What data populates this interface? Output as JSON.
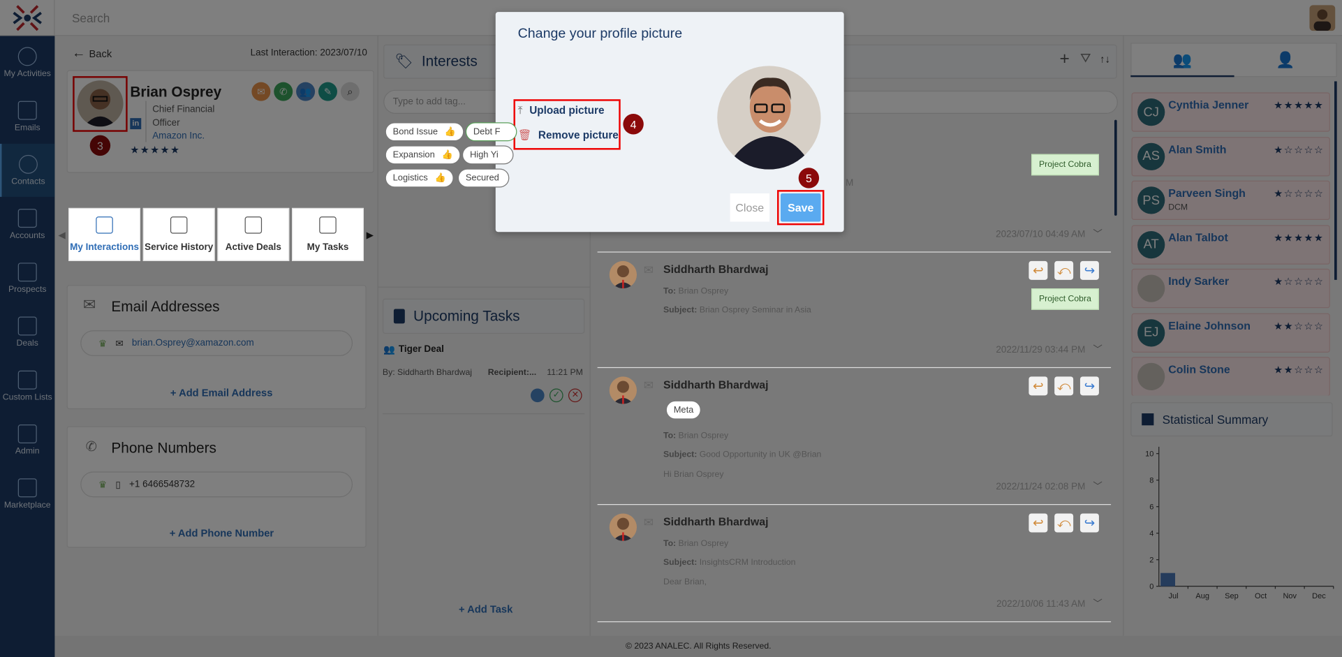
{
  "topbar": {
    "search_placeholder": "Search"
  },
  "sidebar": {
    "items": [
      {
        "label": "My Activities",
        "icon": "user-activity-icon"
      },
      {
        "label": "Emails",
        "icon": "envelope-icon"
      },
      {
        "label": "Contacts",
        "icon": "contact-icon",
        "active": true
      },
      {
        "label": "Accounts",
        "icon": "bank-icon"
      },
      {
        "label": "Prospects",
        "icon": "prospects-chart-icon"
      },
      {
        "label": "Deals",
        "icon": "handshake-icon"
      },
      {
        "label": "Custom Lists",
        "icon": "list-icon"
      },
      {
        "label": "Admin",
        "icon": "user-gear-icon"
      },
      {
        "label": "Marketplace",
        "icon": "marketplace-icon"
      }
    ]
  },
  "profile": {
    "back_label": "Back",
    "last_interaction": "Last Interaction: 2023/07/10",
    "name": "Brian Osprey",
    "title_line1": "Chief Financial",
    "title_line2": "Officer",
    "company": "Amazon Inc.",
    "rating": 5,
    "step_badge": "3"
  },
  "tabs": [
    {
      "label": "My Interactions",
      "active": true
    },
    {
      "label": "Service History"
    },
    {
      "label": "Active Deals"
    },
    {
      "label": "My Tasks"
    }
  ],
  "emails": {
    "title": "Email Addresses",
    "value": "brian.Osprey@xamazon.com",
    "add_label": "+ Add Email Address"
  },
  "phones": {
    "title": "Phone Numbers",
    "value": "+1 6466548732",
    "add_label": "+ Add Phone Number"
  },
  "interests": {
    "title": "Interests",
    "input_placeholder": "Type to add tag...",
    "tags": [
      [
        "Bond Issue",
        "Debt F"
      ],
      [
        "Expansion",
        "High Yi"
      ],
      [
        "Logistics",
        "Secured"
      ]
    ]
  },
  "tasks": {
    "title": "Upcoming Tasks",
    "item": {
      "name": "Tiger Deal",
      "by": "By: Siddharth Bhardwaj",
      "recipient": "Recipient:...",
      "time": "11:21 PM"
    },
    "add_label": "+ Add Task"
  },
  "interactions": [
    {
      "tag": "Project Cobra",
      "timestamp": "2023/07/10 04:49 AM",
      "partial": "M"
    },
    {
      "from": "Siddharth Bhardwaj",
      "to": "Brian Osprey",
      "subject": "Brian Osprey Seminar in Asia",
      "tag": "Project Cobra",
      "timestamp": "2022/11/29 03:44 PM"
    },
    {
      "from": "Siddharth Bhardwaj",
      "chip": "Meta",
      "to": "Brian Osprey",
      "subject": "Good Opportunity in UK @Brian",
      "body": "Hi Brian Osprey",
      "timestamp": "2022/11/24 02:08 PM"
    },
    {
      "from": "Siddharth Bhardwaj",
      "to": "Brian Osprey",
      "subject": "InsightsCRM Introduction",
      "body": "Dear Brian,",
      "timestamp": "2022/10/06 11:43 AM"
    }
  ],
  "labels": {
    "to": "To:",
    "subject": "Subject:"
  },
  "contacts": [
    {
      "initials": "CJ",
      "name": "Cynthia Jenner",
      "rating": 5
    },
    {
      "initials": "AS",
      "name": "Alan Smith",
      "rating": 1
    },
    {
      "initials": "PS",
      "name": "Parveen Singh",
      "sub": "DCM",
      "rating": 1
    },
    {
      "initials": "AT",
      "name": "Alan Talbot",
      "rating": 5
    },
    {
      "initials": "",
      "name": "Indy Sarker",
      "rating": 1,
      "photo": true
    },
    {
      "initials": "EJ",
      "name": "Elaine Johnson",
      "rating": 2
    },
    {
      "initials": "",
      "name": "Colin Stone",
      "rating": 2,
      "photo": true
    }
  ],
  "summary": {
    "title": "Statistical Summary"
  },
  "chart_data": {
    "type": "bar",
    "categories": [
      "Jul",
      "Aug",
      "Sep",
      "Oct",
      "Nov",
      "Dec"
    ],
    "values": [
      1,
      0,
      0,
      0,
      0,
      0
    ],
    "ylim": [
      0,
      10
    ],
    "yticks": [
      0,
      2,
      4,
      6,
      8,
      10
    ],
    "color": "#4a78b8"
  },
  "modal": {
    "title": "Change your profile picture",
    "upload_label": "Upload picture",
    "remove_label": "Remove picture",
    "close_label": "Close",
    "save_label": "Save",
    "step4": "4",
    "step5": "5"
  },
  "footer": {
    "text": "© 2023 ANALEC. All Rights Reserved."
  },
  "colors": {
    "sidebar": "#1c3a66",
    "accent": "#2f6db5",
    "save": "#5aaaf0",
    "highlight": "#e00000",
    "badge": "#8b0a0a"
  }
}
